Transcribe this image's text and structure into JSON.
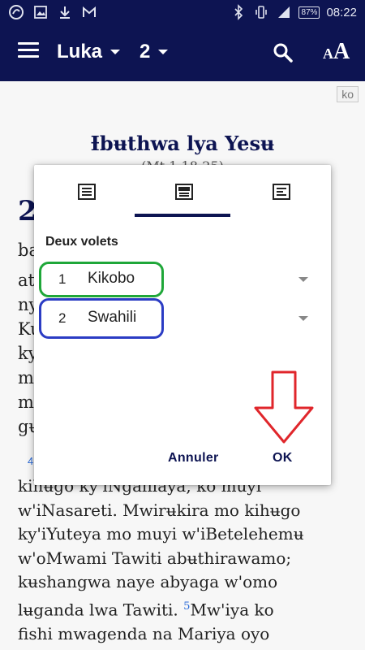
{
  "status_bar": {
    "battery": "87%",
    "time": "08:22",
    "icons": [
      "app-icon",
      "image-icon",
      "download-icon",
      "gmail-icon",
      "bluetooth-icon",
      "vibrate-icon",
      "signal-icon",
      "battery-icon"
    ]
  },
  "toolbar": {
    "book": "Luka",
    "chapter": "2",
    "text_size_small": "A",
    "text_size_big": "A"
  },
  "content": {
    "lang_badge": "ko",
    "section_title": "Ɨbʉthwa lya Yesʉ",
    "section_ref": "(Mt 1.18-25)",
    "chapter_number": "2",
    "left_fragments": [
      "ba",
      "at",
      "ny",
      "Ku",
      "ky",
      "m",
      "m",
      "gʉ"
    ],
    "verse_fragment": "4",
    "lines": [
      "kihʉgo ky'iNgalilaya, ko muyi",
      "w'iNasareti. Mwirʉkira mo kihʉgo",
      "ky'iYuteya mo muyi w'iBetelehemʉ",
      "w'oMwami Tawiti abʉthirawamo;",
      "kʉshangwa naye abyaga w'omo",
      "lʉganda lwa Tawiti."
    ],
    "verse_5_number": "5",
    "verse_5_start": "Mw'iya ko",
    "last_line": "fishi mwagenda na Mariya oyo"
  },
  "dialog": {
    "heading": "Deux volets",
    "rows": [
      {
        "num": "1",
        "label": "Kikobo"
      },
      {
        "num": "2",
        "label": "Swahili"
      }
    ],
    "cancel": "Annuler",
    "ok": "OK"
  },
  "colors": {
    "primary": "#0d1452",
    "highlight_green": "#1fa739",
    "highlight_blue": "#2b3cc4",
    "arrow_red": "#e0262b",
    "verse_number": "#2a6ad8"
  }
}
